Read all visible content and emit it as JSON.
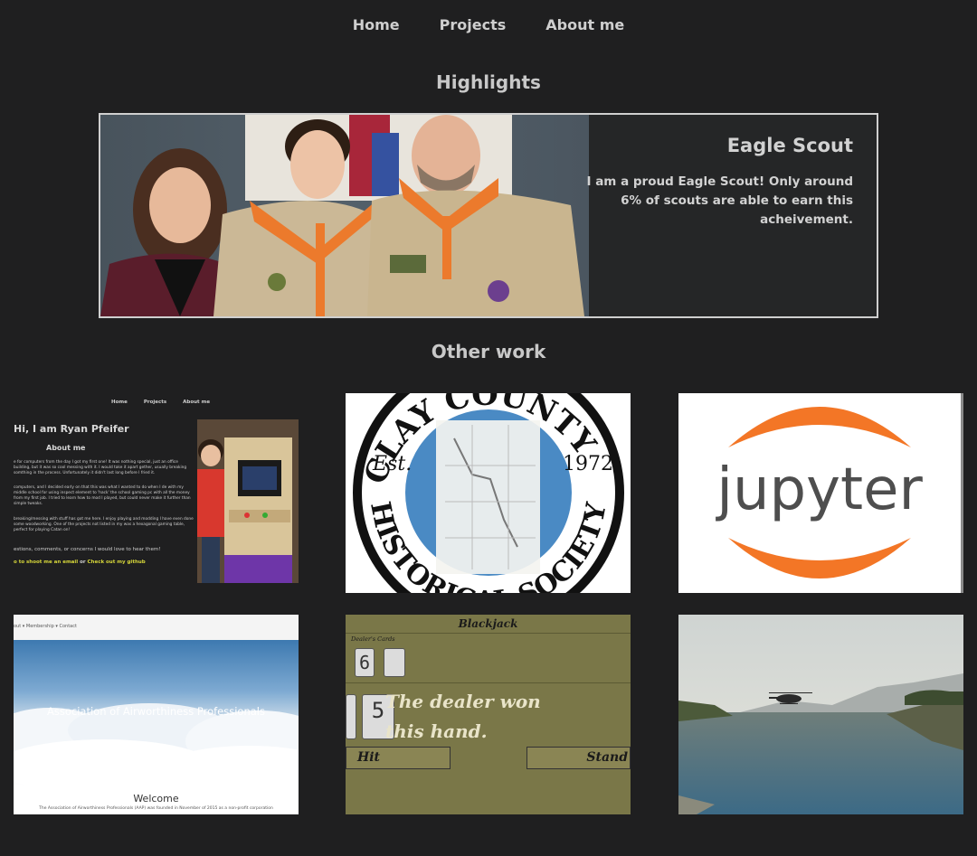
{
  "nav": {
    "items": [
      "Home",
      "Projects",
      "About me"
    ]
  },
  "highlights": {
    "heading": "Highlights",
    "card_title": "Eagle Scout",
    "card_desc": "I am a proud Eagle Scout! Only around 6% of scouts are able to earn this acheivement."
  },
  "other_work": {
    "heading": "Other work"
  },
  "tiles": {
    "portfolio": {
      "nav": [
        "Home",
        "Projects",
        "About me"
      ],
      "greeting": "Hi, I am Ryan Pfeifer",
      "about_heading": "About me",
      "para1": "e for computers from the day I got my first one! It was nothing special, just an office building, but it was so cool messing with it. I would take it apart gether, usually breaking somthing in the process. Unfortunately it didn't last long before I fried it.",
      "para2": "computers, and I decided early on that this was what I wanted to do when I de with my middle school for using inspect element to 'hack' the school gaming pc with all the money from my first job. I tried to learn how to mod I played, but could never make it further than simple tweaks.",
      "para3": "breaking/messing with stuff has got me here. I enjoy playing and modding I have even done some woodworking. One of the projects not listed in my was a hexagonal gaming table, perfect for playing Catan on!",
      "para4": "estions, comments, or concerns I would love to hear them!",
      "link_email": "o to shoot me an email",
      "link_or": "or",
      "link_github": "Check out my github"
    },
    "historical": {
      "top_text": "CLAY COUNTY",
      "left_text": "HISTORICAL SOCIETY",
      "est": "Est.",
      "year": "1972"
    },
    "jupyter": {
      "logo_text": "jupyter"
    },
    "aap": {
      "menu": "out ▾   Membership ▾   Contact",
      "title": "Association of Airworthiness Professionals",
      "welcome": "Welcome",
      "sub": "The Association of Airworthiness Professionals (AAP) was founded in November of 2015 as a non-profit corporation"
    },
    "blackjack": {
      "title": "Blackjack",
      "dealer_label": "Dealer's Cards",
      "dealer_card": "6",
      "player_card": "5",
      "message": "The dealer won this hand.",
      "hit": "Hit",
      "stand": "Stand"
    }
  },
  "colors": {
    "background": "#1f1f20",
    "text": "#c9c9c9",
    "jupyter_orange": "#f37626",
    "jupyter_gray": "#4e4e4e",
    "blackjack_felt": "#7a7748"
  }
}
